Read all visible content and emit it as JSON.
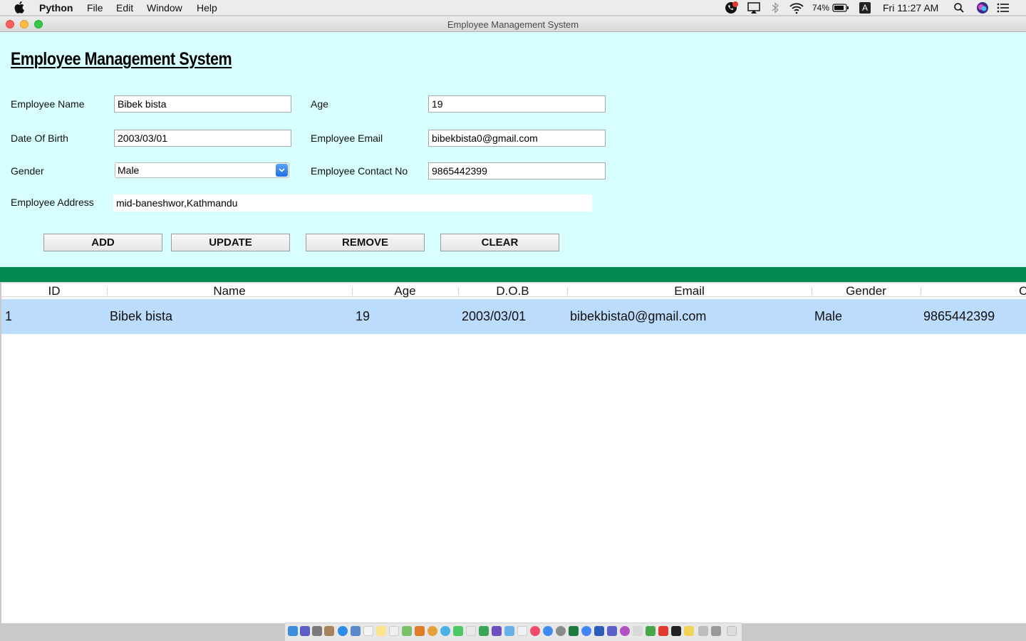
{
  "menubar": {
    "app_name": "Python",
    "menus": [
      "File",
      "Edit",
      "Window",
      "Help"
    ],
    "battery": "74%",
    "input_source": "A",
    "clock": "Fri 11:27 AM"
  },
  "window": {
    "title": "Employee Management System"
  },
  "app": {
    "heading": "Employee Management System"
  },
  "form": {
    "name_label": "Employee Name",
    "name_value": "Bibek bista",
    "age_label": "Age",
    "age_value": "19",
    "dob_label": "Date Of Birth",
    "dob_value": "2003/03/01",
    "email_label": "Employee Email",
    "email_value": "bibekbista0@gmail.com",
    "gender_label": "Gender",
    "gender_value": "Male",
    "contact_label": "Employee Contact No",
    "contact_value": "9865442399",
    "address_label": "Employee Address",
    "address_value": "mid-baneshwor,Kathmandu"
  },
  "buttons": {
    "add": "ADD",
    "update": "UPDATE",
    "remove": "REMOVE",
    "clear": "CLEAR"
  },
  "table": {
    "headers": [
      "ID",
      "Name",
      "Age",
      "D.O.B",
      "Email",
      "Gender",
      "C"
    ],
    "rows": [
      [
        "1",
        "Bibek bista",
        "19",
        "2003/03/01",
        "bibekbista0@gmail.com",
        "Male",
        "9865442399"
      ]
    ]
  },
  "colors": {
    "form_background": "#d8ffff",
    "separator_bar": "#00894e",
    "selected_row": "#bcdcfd"
  },
  "icons": [
    "apple-icon",
    "notification-badge-icon",
    "airplay-icon",
    "bluetooth-icon",
    "wifi-icon",
    "battery-icon",
    "spotlight-icon",
    "siri-icon",
    "notification-center-icon"
  ]
}
